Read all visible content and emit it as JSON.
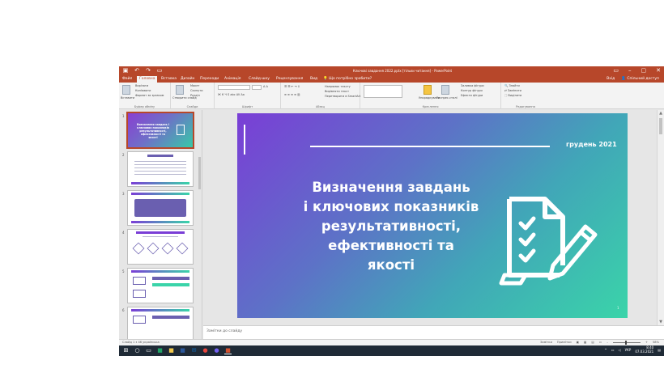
{
  "window": {
    "title": "Ключовi завдання 2022.pptx [тільки читання] - PowerPoint",
    "controls": [
      "▭",
      "–",
      "▢",
      "✕"
    ]
  },
  "qat_icons": [
    "save-icon",
    "undo-icon",
    "redo-icon",
    "present-icon"
  ],
  "tabs": [
    {
      "label": "Файл",
      "active": false
    },
    {
      "label": "Головна",
      "active": true
    },
    {
      "label": "Вставка",
      "active": false
    },
    {
      "label": "Дизайн",
      "active": false
    },
    {
      "label": "Переходи",
      "active": false
    },
    {
      "label": "Анімація",
      "active": false
    },
    {
      "label": "Слайд-шоу",
      "active": false
    },
    {
      "label": "Рецензування",
      "active": false
    },
    {
      "label": "Вид",
      "active": false
    },
    {
      "label": "Що потрібно зробити?",
      "active": false
    }
  ],
  "share": {
    "signin": "Вхід",
    "label": "Спільний доступ"
  },
  "ribbon": {
    "clipboard": {
      "name": "Буфер обміну",
      "paste": "Вставити",
      "cut": "Вирізати",
      "copy": "Копіювати",
      "format_painter": "Формат за зразком"
    },
    "slides": {
      "name": "Слайди",
      "new_slide": "Створити слайд",
      "layout": "Макет",
      "reset": "Скинути",
      "section": "Розділ"
    },
    "font": {
      "name": "Шрифт",
      "font_name": "",
      "font_size": ""
    },
    "paragraph": {
      "name": "Абзац"
    },
    "drawing": {
      "name": "Креслення",
      "arrange": "Упорядкувати",
      "quick_styles": "Експрес-стилі",
      "fill": "Заливка фігури",
      "outline": "Контур фігури",
      "effects": "Ефекти фігури"
    },
    "editing": {
      "name": "Редагування",
      "find": "Знайти",
      "replace": "Замінити",
      "select": "Виділити"
    },
    "text_direction": "Напрямок тексту",
    "align_text": "Вирівняти текст",
    "smartart": "Перетворити в SmartArt"
  },
  "thumbnails": [
    {
      "num": "1",
      "selected": true,
      "title": "Визначення завдань і ключових показників результативності, ефективності та якості"
    },
    {
      "num": "2",
      "selected": false
    },
    {
      "num": "3",
      "selected": false
    },
    {
      "num": "4",
      "selected": false
    },
    {
      "num": "5",
      "selected": false
    },
    {
      "num": "6",
      "selected": false
    }
  ],
  "slide": {
    "date": "грудень 2021",
    "title_lines": [
      "Визначення завдань",
      "і ключових показників",
      "результативності,",
      "ефективності та",
      "якості"
    ],
    "page_number": "1",
    "icon": "checklist-pencil-icon"
  },
  "notes": {
    "placeholder": "Замітки до слайду"
  },
  "status": {
    "left": "Слайд 1 з 46   українська",
    "notes": "Замітки",
    "comments": "Примітки",
    "zoom": "58%"
  },
  "taskbar": {
    "icons": [
      "windows-start-icon",
      "search-icon",
      "task-view-icon",
      "excel-icon",
      "file-explorer-icon",
      "word-icon",
      "mail-icon",
      "chrome-icon",
      "viber-icon",
      "powerpoint-icon"
    ],
    "lang": "УКР",
    "time": "8:40",
    "date": "07.03.2021"
  },
  "colors": {
    "accent": "#b7472a",
    "slide_gradient_start": "#7a3ed6",
    "slide_gradient_end": "#3ad4a9",
    "taskbar": "#1f2a36"
  }
}
